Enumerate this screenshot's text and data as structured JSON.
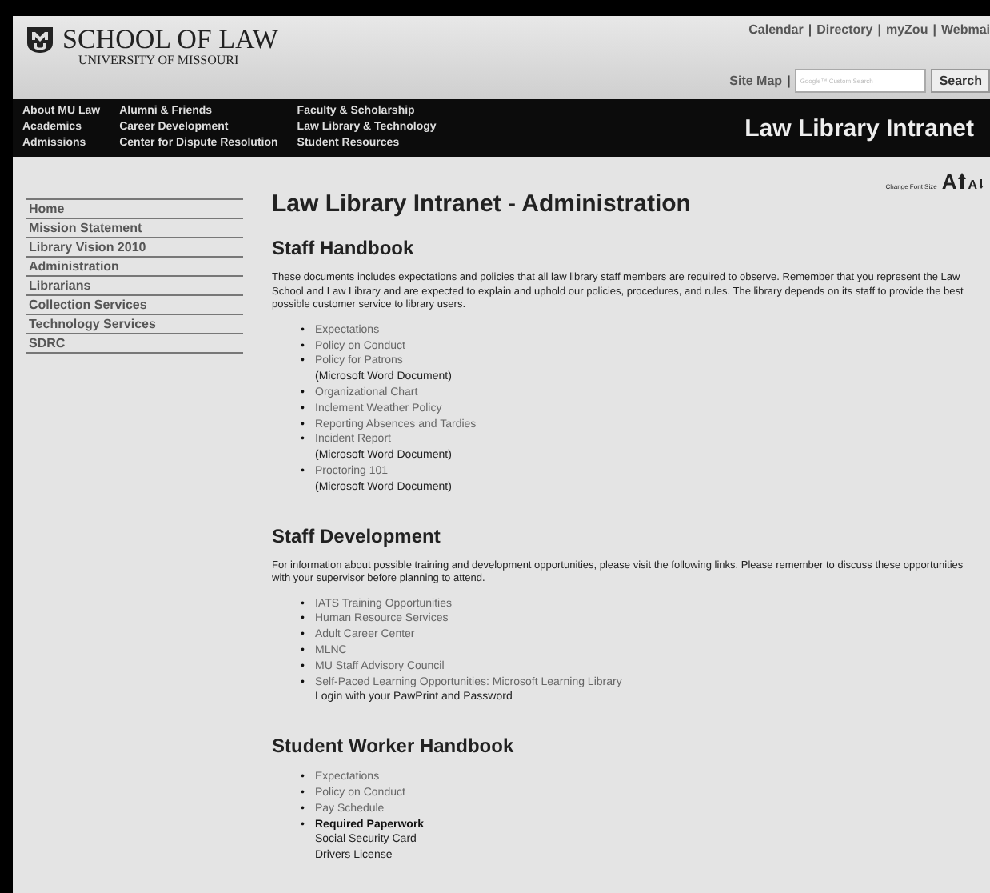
{
  "header": {
    "logo_title": "SCHOOL OF LAW",
    "logo_subtitle": "UNIVERSITY OF MISSOURI",
    "util_links": [
      "Calendar",
      "Directory",
      "myZou",
      "Webmai"
    ],
    "separator": "|",
    "site_map": "Site Map",
    "search": {
      "placeholder": "Google™ Custom Search",
      "button": "Search"
    }
  },
  "nav": {
    "columns": [
      [
        "About MU Law",
        "Academics",
        "Admissions"
      ],
      [
        "Alumni & Friends",
        "Career Development",
        "Center for Dispute Resolution"
      ],
      [
        "Faculty & Scholarship",
        "Law Library & Technology",
        "Student Resources"
      ]
    ],
    "site_title": "Law Library Intranet"
  },
  "font_size": {
    "label": "Change Font Size",
    "larger": "A",
    "smaller": "A"
  },
  "sidebar": {
    "items": [
      "Home",
      "Mission Statement",
      "Library Vision 2010",
      "Administration",
      "Librarians",
      "Collection Services",
      "Technology Services",
      "SDRC"
    ]
  },
  "page_title": "Law Library Intranet - Administration",
  "bullet": "•",
  "sections": [
    {
      "heading": "Staff Handbook",
      "paragraph": "These documents includes expectations and policies that all law library staff members are required to observe. Remember that you represent the Law School and Law Library and are expected to explain and uphold our policies, procedures, and rules. The library depends on its staff to provide the best possible customer service to library users.",
      "items": [
        {
          "kind": "link",
          "text": "Expectations"
        },
        {
          "kind": "link",
          "text": "Policy on Conduct"
        },
        {
          "kind": "link",
          "text": "Policy for Patrons",
          "notes": [
            "(Microsoft Word Document)"
          ]
        },
        {
          "kind": "link",
          "text": "Organizational Chart"
        },
        {
          "kind": "link",
          "text": "Inclement Weather Policy"
        },
        {
          "kind": "link",
          "text": "Reporting Absences and Tardies"
        },
        {
          "kind": "link",
          "text": "Incident Report",
          "notes": [
            "(Microsoft Word Document)"
          ]
        },
        {
          "kind": "link",
          "text": "Proctoring 101",
          "notes": [
            "(Microsoft Word Document)"
          ]
        }
      ]
    },
    {
      "heading": "Staff Development",
      "paragraph": "For information about possible training and development opportunities, please visit the following links. Please remember to discuss these opportunities with your supervisor before planning to attend.",
      "items": [
        {
          "kind": "link",
          "text": "IATS Training Opportunities"
        },
        {
          "kind": "link",
          "text": "Human Resource Services"
        },
        {
          "kind": "link",
          "text": "Adult Career Center"
        },
        {
          "kind": "link",
          "text": "MLNC"
        },
        {
          "kind": "link",
          "text": "MU Staff Advisory Council"
        },
        {
          "kind": "link",
          "text": "Self-Paced Learning Opportunities: Microsoft Learning Library",
          "notes": [
            "Login with your PawPrint and Password"
          ]
        }
      ]
    },
    {
      "heading": "Student Worker Handbook",
      "items": [
        {
          "kind": "link",
          "text": "Expectations"
        },
        {
          "kind": "link",
          "text": "Policy on Conduct"
        },
        {
          "kind": "link",
          "text": "Pay Schedule"
        },
        {
          "kind": "bold",
          "text": "Required Paperwork",
          "notes": [
            "Social Security Card",
            "Drivers License"
          ]
        }
      ]
    }
  ]
}
